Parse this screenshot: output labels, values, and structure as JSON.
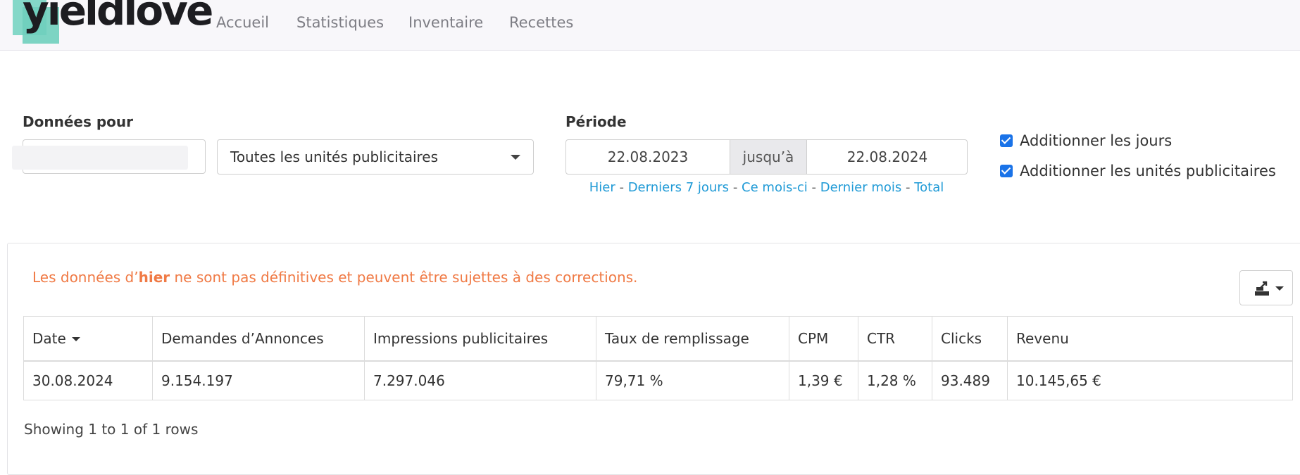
{
  "brand": {
    "logo_text": "yieldlove",
    "accent": "#6fcfbd"
  },
  "nav": {
    "items": [
      {
        "label": "Accueil"
      },
      {
        "label": "Statistiques"
      },
      {
        "label": "Inventaire"
      },
      {
        "label": "Recettes"
      }
    ]
  },
  "filters": {
    "data_for_label": "Données pour",
    "site_value": "",
    "adunit_select_value": "Toutes les unités publicitaires",
    "period_label": "Période",
    "date_from": "22.08.2023",
    "date_separator": "jusqu’à",
    "date_to": "22.08.2024",
    "quick_links": [
      "Hier",
      "Derniers 7 jours",
      "Ce mois-ci",
      "Dernier mois",
      "Total"
    ],
    "quick_link_separator": "-",
    "checkboxes": [
      {
        "label": "Additionner les jours",
        "checked": true
      },
      {
        "label": "Additionner les unités publicitaires",
        "checked": true
      }
    ]
  },
  "panel": {
    "warning_prefix": "Les données d’",
    "warning_bold": "hier",
    "warning_suffix": " ne sont pas définitives et peuvent être sujettes à des corrections.",
    "warning_color": "#f07a45",
    "export_icon": "export-icon"
  },
  "table": {
    "columns": [
      "Date",
      "Demandes d’Annonces",
      "Impressions publicitaires",
      "Taux de remplissage",
      "CPM",
      "CTR",
      "Clicks",
      "Revenu"
    ],
    "rows": [
      [
        "30.08.2024",
        "9.154.197",
        "7.297.046",
        "79,71 %",
        "1,39 €",
        "1,28 %",
        "93.489",
        "10.145,65 €"
      ]
    ],
    "footer": "Showing 1 to 1 of 1 rows"
  },
  "link_color": "#1f9ad6"
}
